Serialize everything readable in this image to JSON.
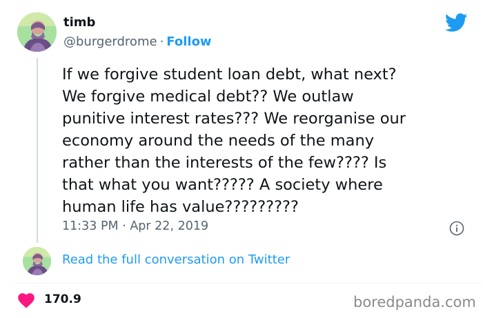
{
  "author": {
    "display_name": "timb",
    "handle": "@burgerdrome",
    "separator": "·",
    "follow_label": "Follow",
    "avatar_icon": "user-avatar"
  },
  "tweet": {
    "text": "If we forgive student loan debt, what next?\nWe forgive medical debt?? We outlaw\npunitive interest rates??? We reorganise our\neconomy around the needs of the many\nrather than the interests of the few???? Is\nthat what you want????? A society where\nhuman life has value?????????",
    "timestamp": "11:33 PM · Apr 22, 2019"
  },
  "thread": {
    "read_more_label": "Read the full conversation on Twitter"
  },
  "actions": {
    "like_count": "170.9",
    "heart_color": "#f91880"
  },
  "icons": {
    "brand": "twitter-bird-icon",
    "info": "info-icon",
    "like": "heart-icon"
  },
  "colors": {
    "accent": "#1d9bf0",
    "text": "#0f1419",
    "secondary": "#536471"
  },
  "watermark": {
    "text": "boredpanda.com"
  }
}
